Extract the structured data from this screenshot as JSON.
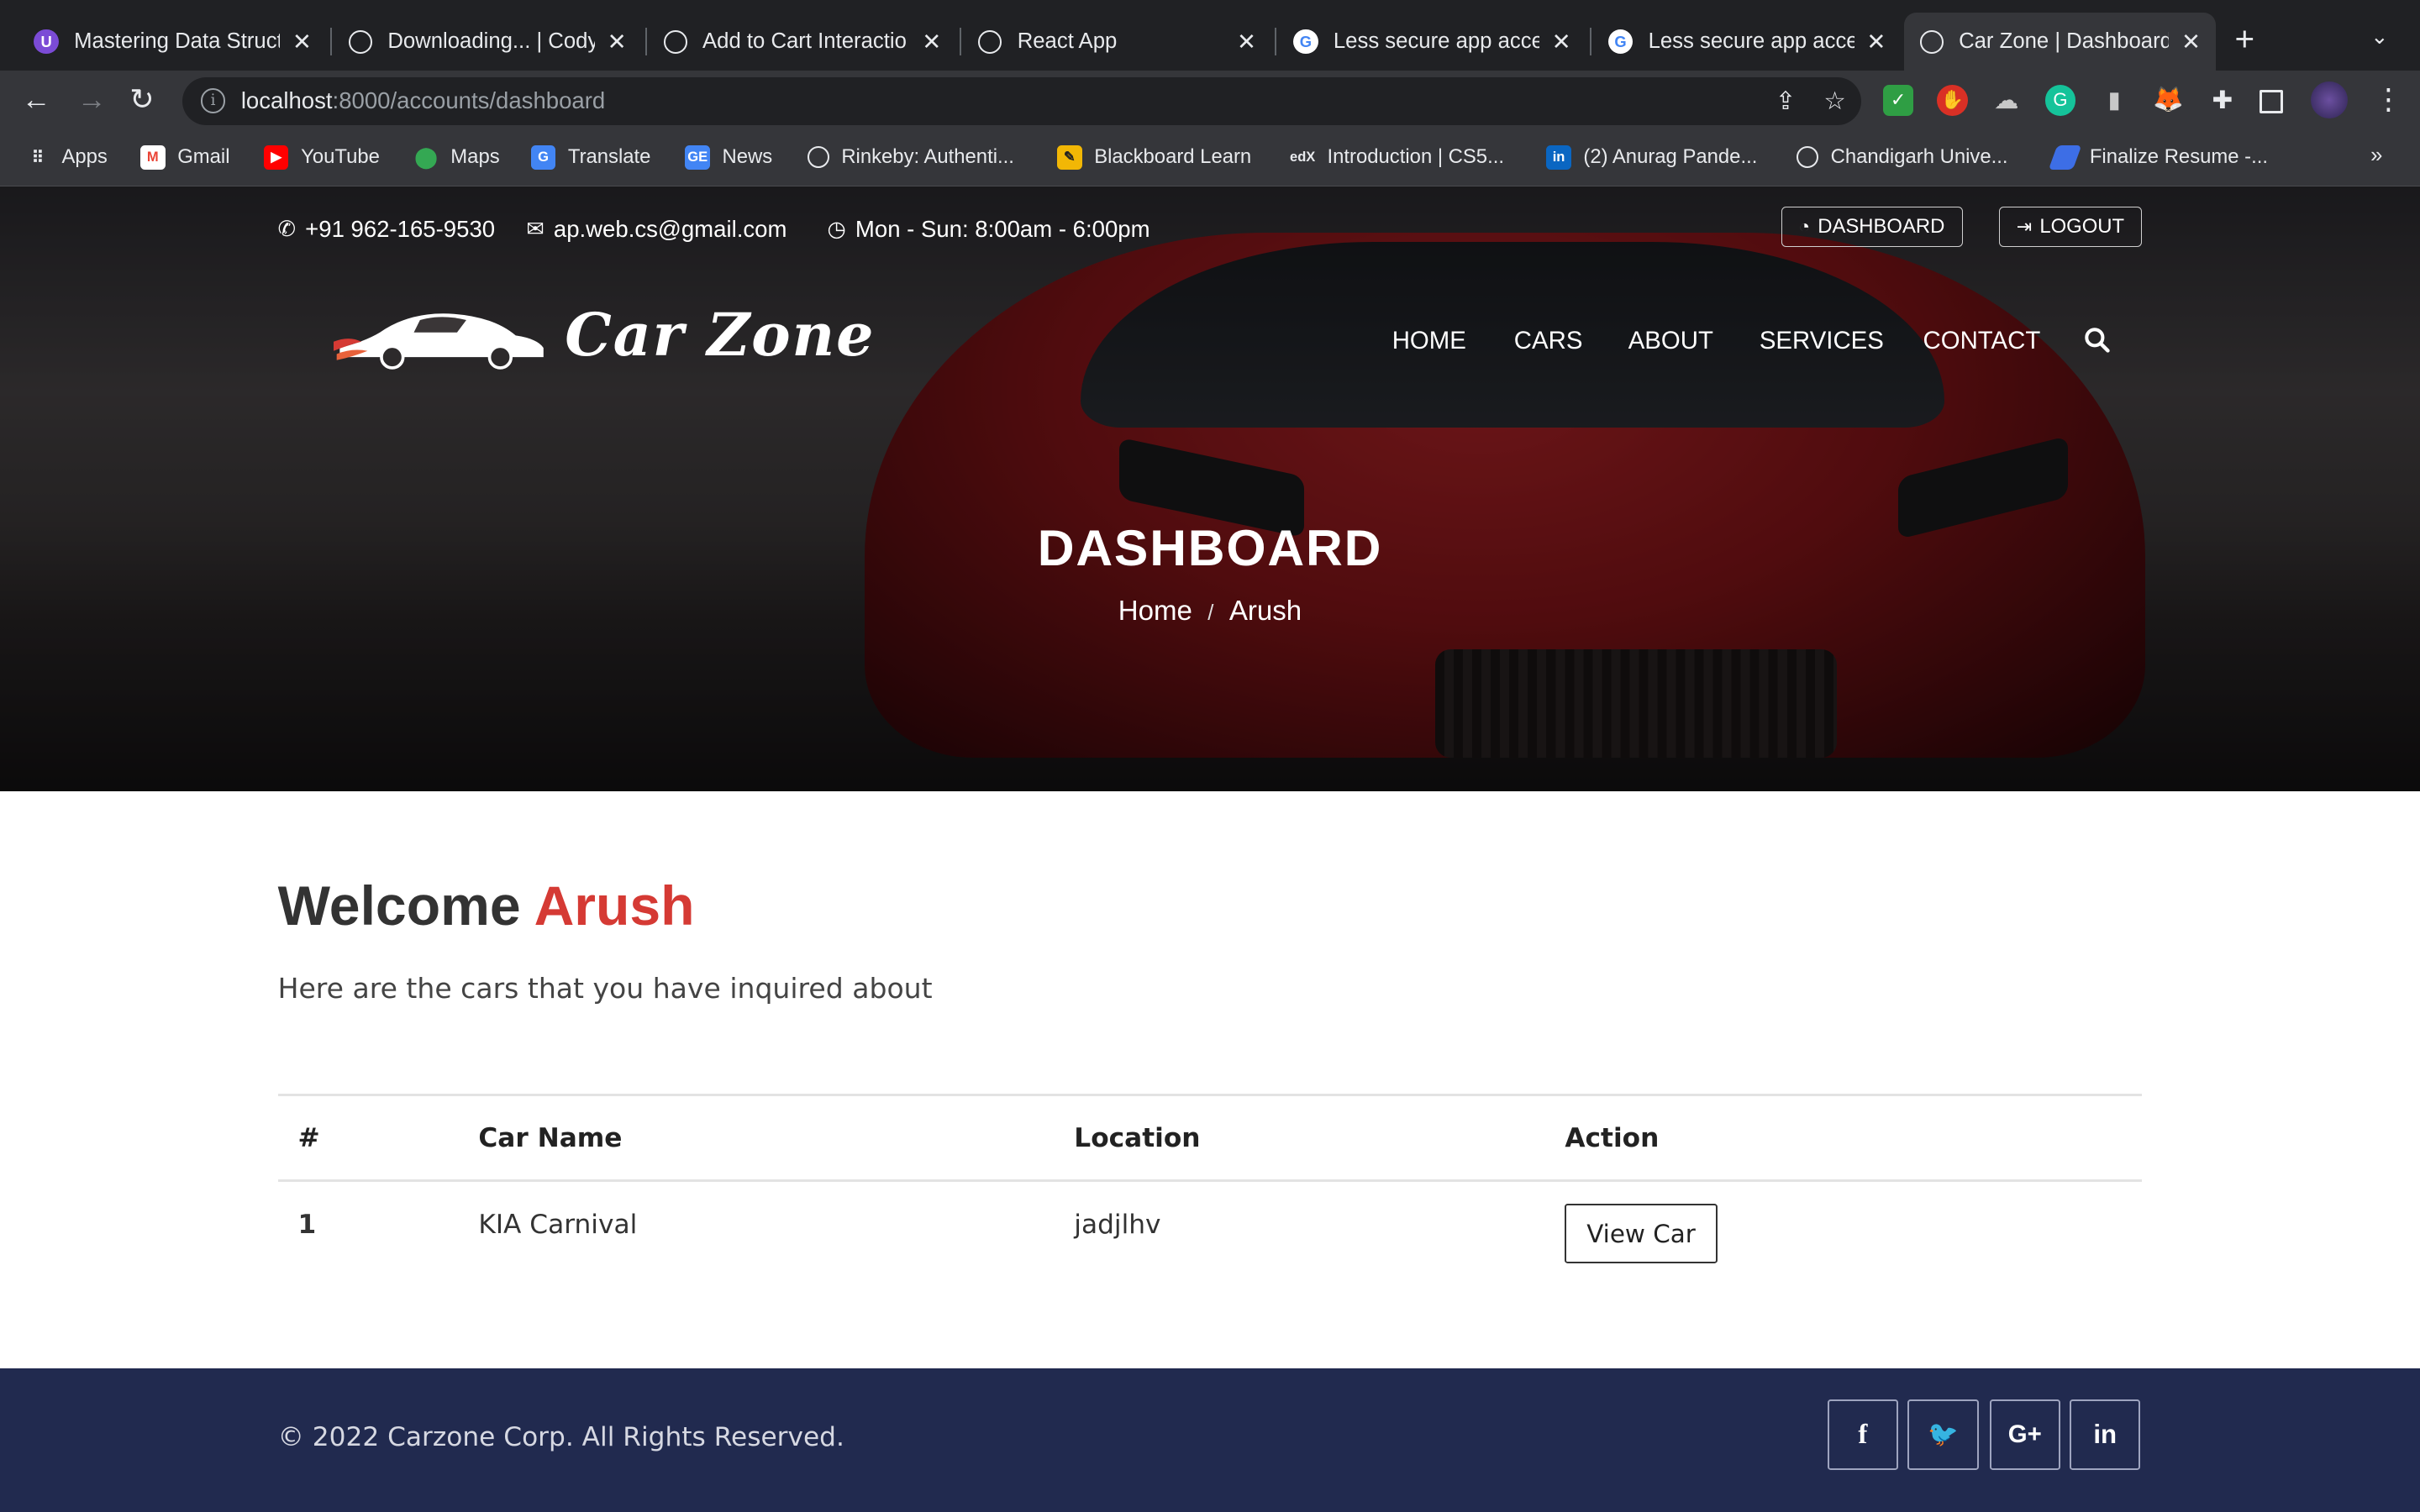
{
  "browser": {
    "tabs": [
      {
        "title": "Mastering Data Structu",
        "favicon": "U"
      },
      {
        "title": "Downloading... | Cody",
        "favicon": "globe"
      },
      {
        "title": "Add to Cart Interactio",
        "favicon": "globe"
      },
      {
        "title": "React App",
        "favicon": "globe"
      },
      {
        "title": "Less secure app acce",
        "favicon": "G"
      },
      {
        "title": "Less secure app acce",
        "favicon": "G"
      },
      {
        "title": "Car Zone | Dashboard",
        "favicon": "globe"
      }
    ],
    "url_host": "localhost",
    "url_path": ":8000/accounts/dashboard",
    "bookmarks": [
      {
        "label": "Apps"
      },
      {
        "label": "Gmail"
      },
      {
        "label": "YouTube"
      },
      {
        "label": "Maps"
      },
      {
        "label": "Translate"
      },
      {
        "label": "News"
      },
      {
        "label": "Rinkeby: Authenti..."
      },
      {
        "label": "Blackboard Learn"
      },
      {
        "label": "Introduction | CS5..."
      },
      {
        "label": "(2) Anurag Pande..."
      },
      {
        "label": "Chandigarh Unive..."
      },
      {
        "label": "Finalize Resume -..."
      }
    ]
  },
  "topbar": {
    "phone": "+91 962-165-9530",
    "email": "ap.web.cs@gmail.com",
    "hours": "Mon - Sun: 8:00am - 6:00pm",
    "dashboard_btn": "DASHBOARD",
    "logout_btn": "LOGOUT"
  },
  "logo": {
    "text": "Car Zone"
  },
  "nav": {
    "home": "HOME",
    "cars": "CARS",
    "about": "ABOUT",
    "services": "SERVICES",
    "contact": "CONTACT"
  },
  "hero": {
    "title": "DASHBOARD",
    "crumb_home": "Home",
    "crumb_sep": "/",
    "crumb_current": "Arush"
  },
  "content": {
    "welcome_prefix": "Welcome",
    "welcome_name": "Arush",
    "subtitle": "Here are the cars that you have inquired about",
    "table": {
      "headers": [
        "#",
        "Car Name",
        "Location",
        "Action"
      ],
      "rows": [
        {
          "num": "1",
          "car": "KIA Carnival",
          "location": "jadjlhv",
          "action": "View Car"
        }
      ]
    }
  },
  "footer": {
    "copyright": "© 2022 Carzone Corp. All Rights Reserved.",
    "social": [
      {
        "icon": "facebook-icon",
        "glyph": "f"
      },
      {
        "icon": "twitter-icon",
        "glyph": "🐦"
      },
      {
        "icon": "google-plus-icon",
        "glyph": "G+"
      },
      {
        "icon": "linkedin-icon",
        "glyph": "in"
      }
    ]
  },
  "colors": {
    "accent_red": "#d53a34",
    "footer_bg": "#212a4f",
    "chrome_dark": "#202124"
  }
}
